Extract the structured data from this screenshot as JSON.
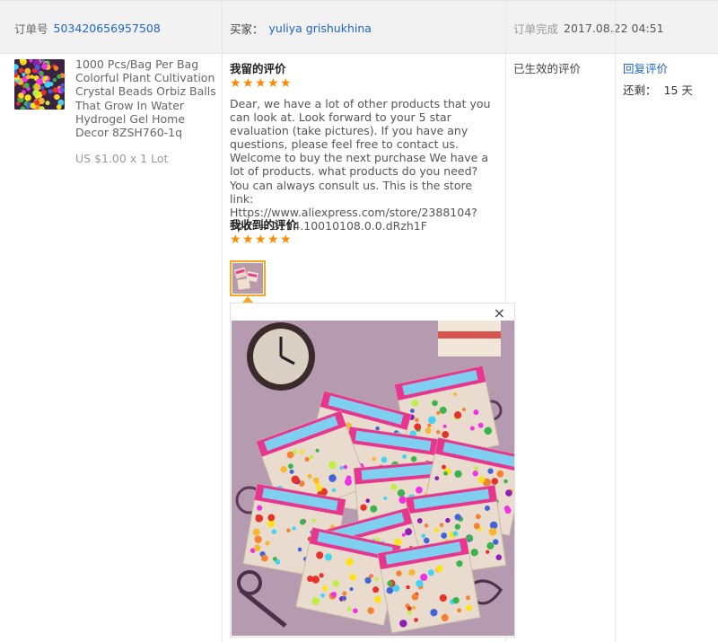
{
  "header": {
    "order_label": "订单号",
    "order_number": "503420656957508",
    "buyer_label": "买家：",
    "buyer_name": "yuliya grishukhina",
    "completed_label": "订单完成",
    "completed_time": "2017.08.22 04:51"
  },
  "product": {
    "title": "1000 Pcs/Bag Per Bag Colorful Plant Cultivation Crystal Beads Orbiz Balls That Grow In Water Hydrogel Gel Home Decor 8ZSH760-1q",
    "price": "US $1.00 x 1 Lot"
  },
  "my_review": {
    "title": "我留的评价",
    "stars": 5,
    "text": "Dear, we have a lot of other products that you can look at. Look forward to your 5 star evaluation (take pictures). If you have any questions, please feel free to contact us. Welcome to buy the next purchase We have a lot of products. what products do you need? You can always consult us. This is the store link: Https://www.aliexpress.com/store/2388104?Spm = 2114.10010108.0.0.dRzh1F"
  },
  "received_review": {
    "title": "我收到的评价",
    "stars": 5
  },
  "viewer": {
    "close_symbol": "×"
  },
  "status": {
    "text": "已生效的评价"
  },
  "actions": {
    "reply_label": "回复评价",
    "remaining_label": "还剩：",
    "remaining_value": "15 天"
  },
  "colors": {
    "link": "#1d65c9",
    "star": "#ff8a00",
    "thumb_border": "#f5a623",
    "header_bg": "#f2f2f2"
  }
}
